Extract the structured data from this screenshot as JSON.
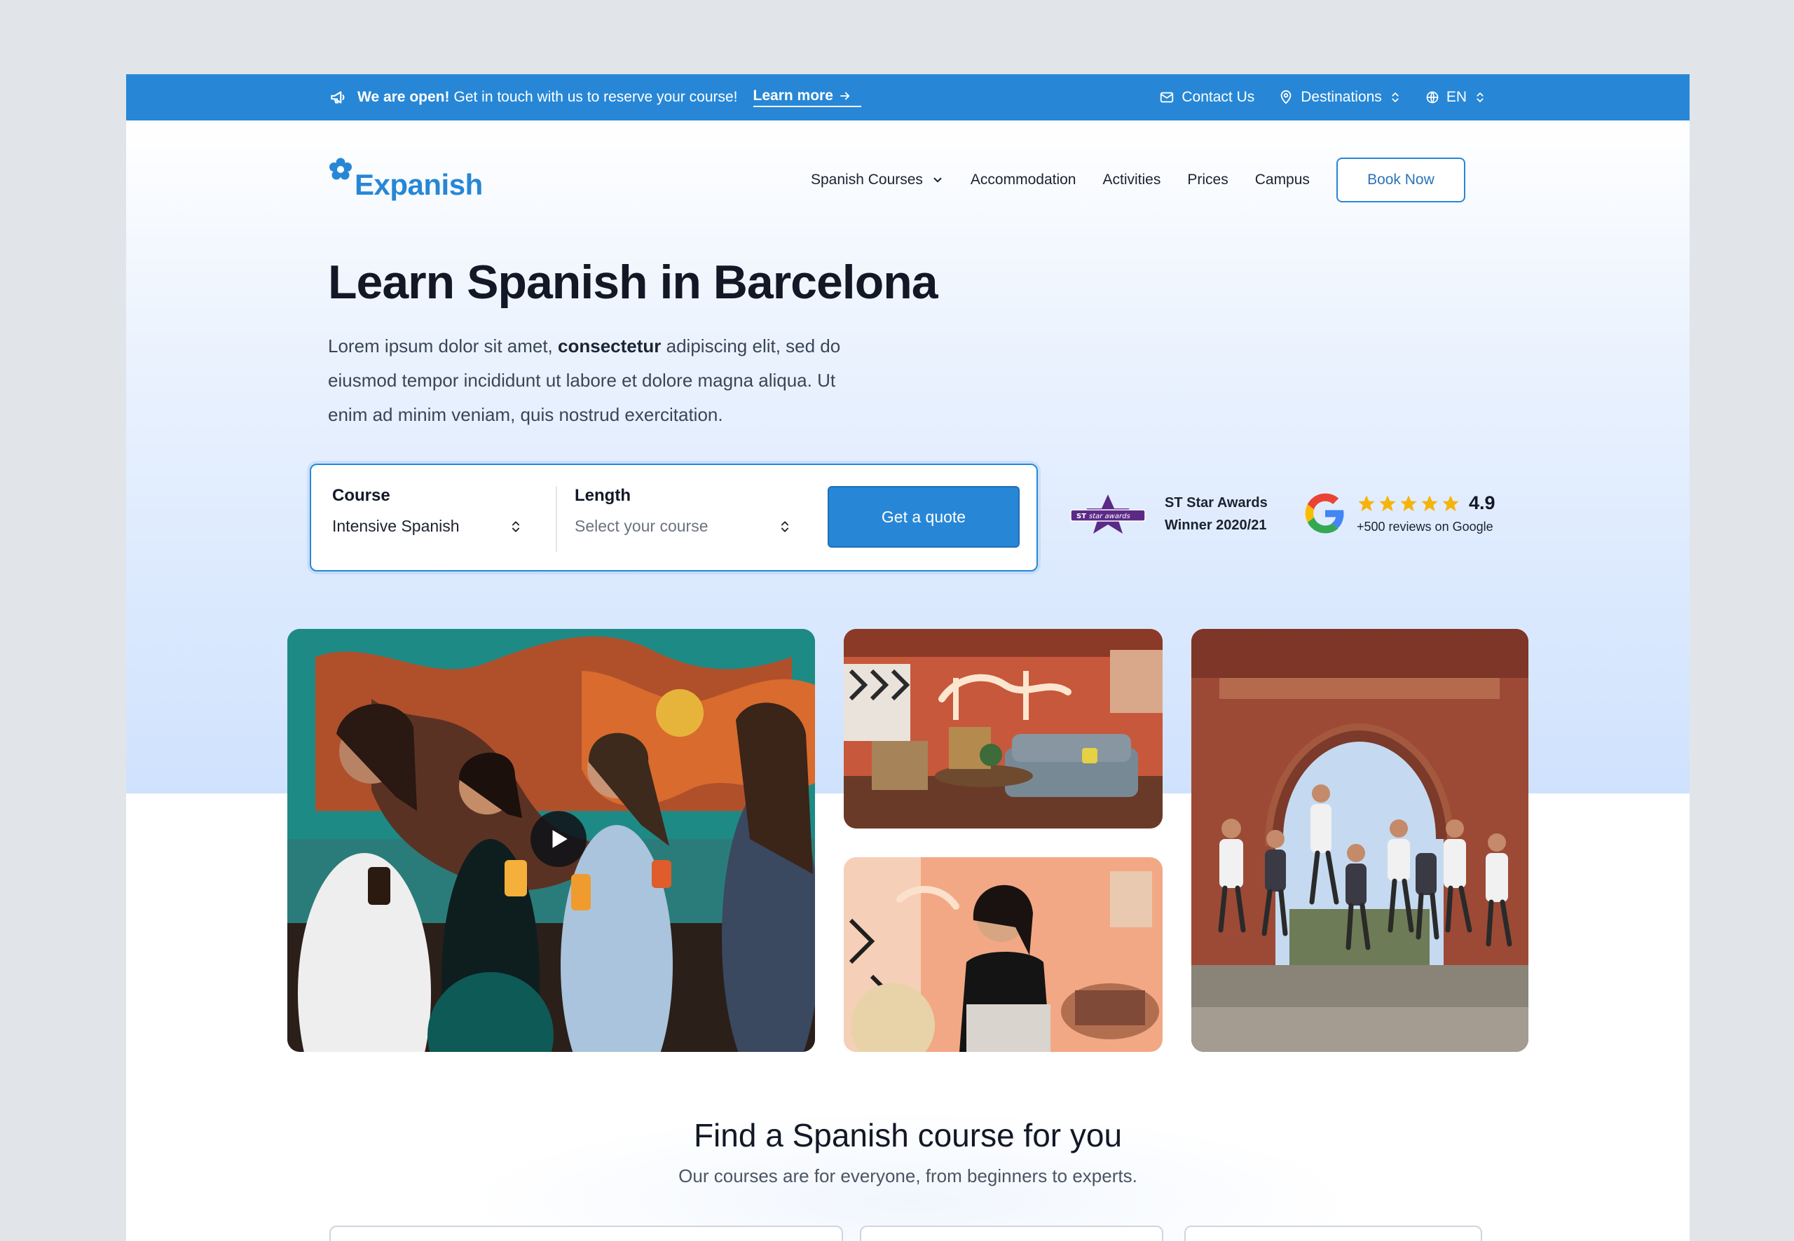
{
  "topbar": {
    "announce_bold": "We are open!",
    "announce_text": "Get in touch with us to reserve your course!",
    "learn_more": "Learn more",
    "contact": "Contact Us",
    "destinations": "Destinations",
    "language": "EN"
  },
  "brand": {
    "name": "Expanish"
  },
  "nav": {
    "items": [
      "Spanish Courses",
      "Accommodation",
      "Activities",
      "Prices",
      "Campus"
    ],
    "book": "Book Now"
  },
  "hero": {
    "title": "Learn Spanish in Barcelona",
    "lede_start": "Lorem ipsum dolor sit amet, ",
    "lede_bold": "consectetur",
    "lede_end": " adipiscing elit, sed do eiusmod tempor incididunt ut labore et dolore magna aliqua. Ut enim ad minim veniam, quis nostrud exercitation."
  },
  "quote_form": {
    "course_label": "Course",
    "course_value": "Intensive Spanish",
    "length_label": "Length",
    "length_placeholder": "Select your course",
    "submit": "Get a quote"
  },
  "awards": {
    "badge_text": "star awards",
    "badge_mark": "ST",
    "line1": "ST Star Awards",
    "line2": "Winner 2020/21"
  },
  "google": {
    "stars": 5,
    "rating": "4.9",
    "reviews": "+500 reviews on Google"
  },
  "section": {
    "title": "Find a Spanish course for you",
    "subtitle": "Our courses are for everyone, from beginners to experts."
  },
  "colors": {
    "primary": "#2787d6",
    "star": "#f6b30a",
    "award_purple": "#5b2a86"
  }
}
